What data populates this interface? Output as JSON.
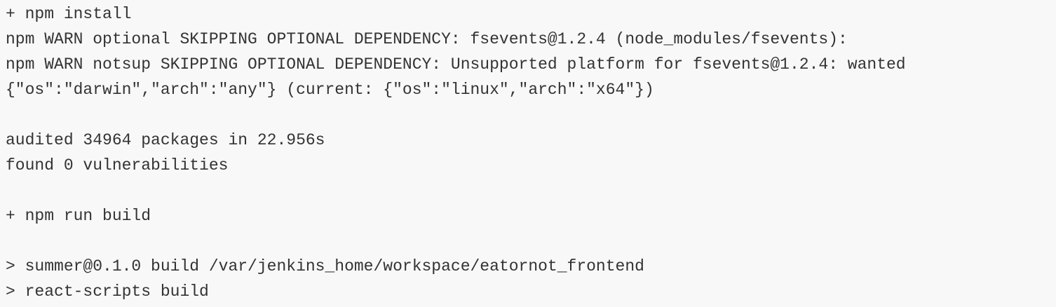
{
  "console": {
    "lines": [
      "+ npm install",
      "npm WARN optional SKIPPING OPTIONAL DEPENDENCY: fsevents@1.2.4 (node_modules/fsevents):",
      "npm WARN notsup SKIPPING OPTIONAL DEPENDENCY: Unsupported platform for fsevents@1.2.4: wanted",
      "{\"os\":\"darwin\",\"arch\":\"any\"} (current: {\"os\":\"linux\",\"arch\":\"x64\"})",
      "",
      "audited 34964 packages in 22.956s",
      "found 0 vulnerabilities",
      "",
      "+ npm run build",
      "",
      "> summer@0.1.0 build /var/jenkins_home/workspace/eatornot_frontend",
      "> react-scripts build"
    ]
  }
}
